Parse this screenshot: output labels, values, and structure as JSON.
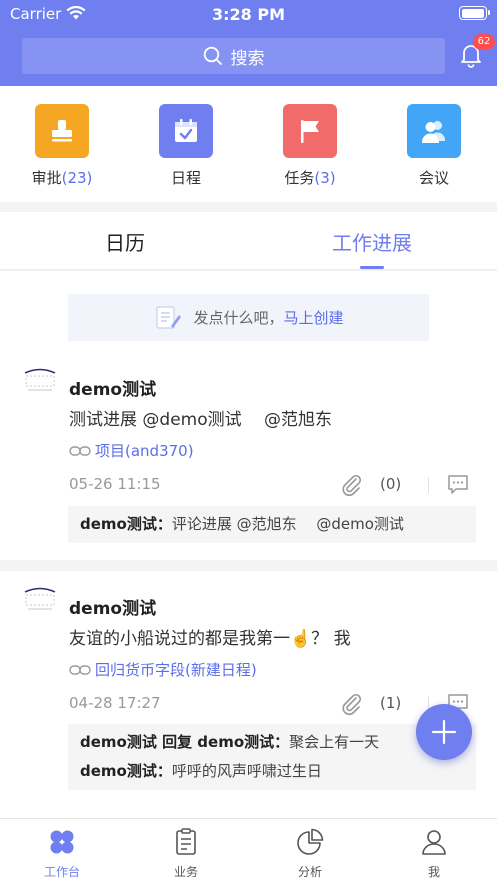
{
  "status": {
    "carrier": "Carrier",
    "time": "3:28 PM",
    "battery_level": 1.0
  },
  "header": {
    "search_label": "搜索",
    "notification_badge": "62",
    "accent": "#6f7fef"
  },
  "shortcuts": [
    {
      "label": "审批",
      "count": "(23)",
      "icon": "approval-stamp-icon",
      "color": "#f5a623"
    },
    {
      "label": "日程",
      "count": "",
      "icon": "calendar-icon",
      "color": "#6f7fef"
    },
    {
      "label": "任务",
      "count": "(3)",
      "icon": "flag-icon",
      "color": "#f26b6b"
    },
    {
      "label": "会议",
      "count": "",
      "icon": "people-icon",
      "color": "#42a5f5"
    }
  ],
  "tabs": [
    {
      "label": "日历",
      "active": false
    },
    {
      "label": "工作进展",
      "active": true
    }
  ],
  "create_banner": {
    "prompt": "发点什么吧，",
    "link": "马上创建"
  },
  "posts": [
    {
      "author": "demo测试",
      "text": "测试进展 @demo测试　 @范旭东",
      "link": "项目(and370)",
      "date": "05-26 11:15",
      "attachment_count": "(0)",
      "comments": [
        {
          "speaker": "demo测试：",
          "text": "评论进展 @范旭东　 @demo测试"
        }
      ]
    },
    {
      "author": "demo测试",
      "text": "友谊的小船说过的都是我第一☝️？ 我",
      "link": "回归货币字段(新建日程)",
      "date": "04-28 17:27",
      "attachment_count": "(1)",
      "comments": [
        {
          "speaker": "demo测试 回复 demo测试：",
          "text": "聚会上有一天"
        },
        {
          "speaker": "demo测试：",
          "text": "呼呼的风声呼啸过生日"
        }
      ]
    }
  ],
  "bottom_nav": [
    {
      "label": "工作台",
      "icon": "workbench-icon",
      "active": true
    },
    {
      "label": "业务",
      "icon": "clipboard-icon",
      "active": false
    },
    {
      "label": "分析",
      "icon": "pie-chart-icon",
      "active": false
    },
    {
      "label": "我",
      "icon": "person-icon",
      "active": false
    }
  ]
}
